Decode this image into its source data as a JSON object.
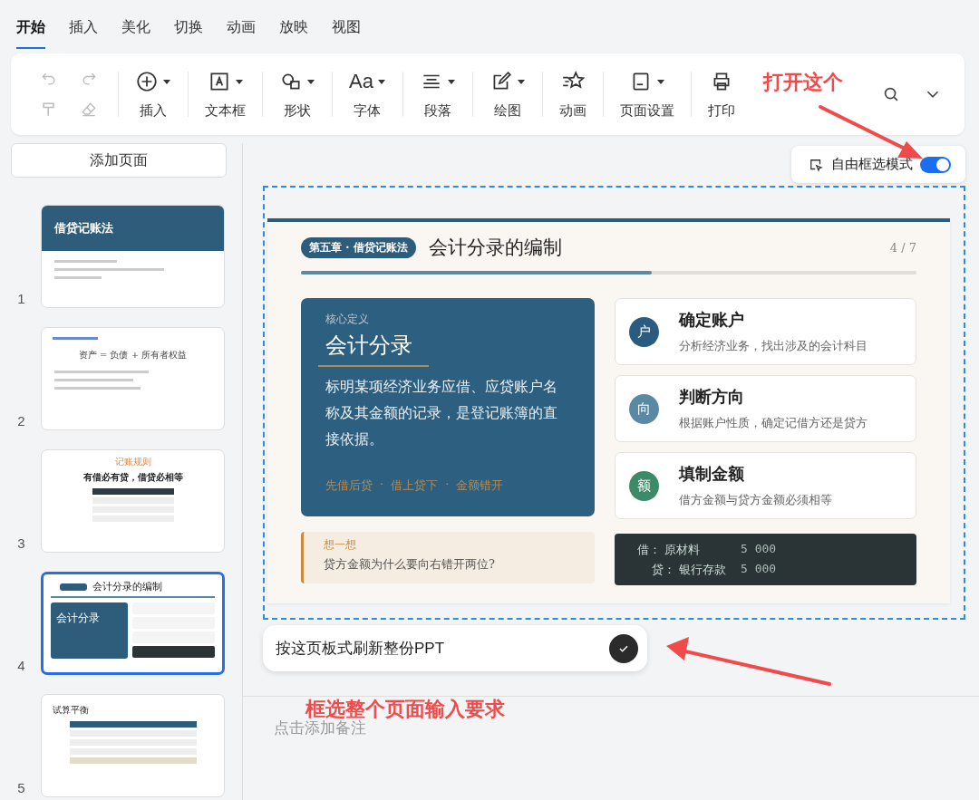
{
  "tabs": [
    {
      "label": "开始",
      "selected": true
    },
    {
      "label": "插入",
      "selected": false
    },
    {
      "label": "美化",
      "selected": false
    },
    {
      "label": "切换",
      "selected": false
    },
    {
      "label": "动画",
      "selected": false
    },
    {
      "label": "放映",
      "selected": false
    },
    {
      "label": "视图",
      "selected": false
    }
  ],
  "quick_tools": [
    {
      "disabled": true
    },
    {
      "disabled": true
    },
    {
      "disabled": true
    },
    {
      "disabled": true
    }
  ],
  "toolbar": [
    {
      "label": "插入",
      "caret": true
    },
    {
      "label": "文本框",
      "caret": true
    },
    {
      "label": "形状",
      "caret": true
    },
    {
      "label": "字体",
      "caret": true,
      "glyph": "Aa"
    },
    {
      "label": "段落",
      "caret": true
    },
    {
      "label": "绘图",
      "caret": true
    },
    {
      "label": "动画",
      "caret": false
    },
    {
      "label": "页面设置",
      "caret": true
    },
    {
      "label": "打印",
      "caret": false
    }
  ],
  "add_page": "添加页面",
  "thumbnails": [
    {
      "number": "1",
      "selected": false,
      "texts": [
        "借贷记账法"
      ]
    },
    {
      "number": "2",
      "selected": false,
      "texts": [
        "资产 = 负债 + 所有者权益"
      ]
    },
    {
      "number": "3",
      "selected": false,
      "texts": [
        "记账规则",
        "有借必有贷，借贷必相等"
      ]
    },
    {
      "number": "4",
      "selected": true,
      "texts": [
        "会计分录的编制",
        "会计分录"
      ]
    },
    {
      "number": "5",
      "selected": false,
      "texts": [
        "试算平衡"
      ]
    }
  ],
  "free_select": {
    "label": "自由框选模式",
    "on": true
  },
  "slide": {
    "chapter": "第五章 · 借贷记账法",
    "title": "会计分录的编制",
    "page": "4 / 7",
    "progress": {
      "level": 0.57
    },
    "definition": {
      "label": "核心定义",
      "title": "会计分录",
      "body": "标明某项经济业务应借、应贷账户名称及其金额的记录，是登记账簿的直接依据。",
      "tags": [
        "先借后贷",
        "借上贷下",
        "金额错开"
      ],
      "separator": "·"
    },
    "think": {
      "label": "想一想",
      "text": "贷方金额为什么要向右错开两位?"
    },
    "steps": [
      {
        "badge": "户",
        "title": "确定账户",
        "text": "分析经济业务，找出涉及的会计科目",
        "color": "#2b5b7e"
      },
      {
        "badge": "向",
        "title": "判断方向",
        "text": "根据账户性质，确定记借方还是贷方",
        "color": "#5a8aa3"
      },
      {
        "badge": "额",
        "title": "填制金额",
        "text": "借方金额与贷方金额必须相等",
        "color": "#3d8a68"
      }
    ],
    "journal": [
      {
        "side": "借：",
        "account": "原材料",
        "amount": "5 000"
      },
      {
        "side": "贷：",
        "account": "银行存款",
        "amount": "5 000"
      }
    ]
  },
  "refresh_field": {
    "value": "按这页板式刷新整份PPT"
  },
  "notes": {
    "placeholder": "点击添加备注"
  },
  "annotations": [
    {
      "text": "打开这个"
    },
    {
      "text": "框选整个页面输入要求"
    }
  ]
}
